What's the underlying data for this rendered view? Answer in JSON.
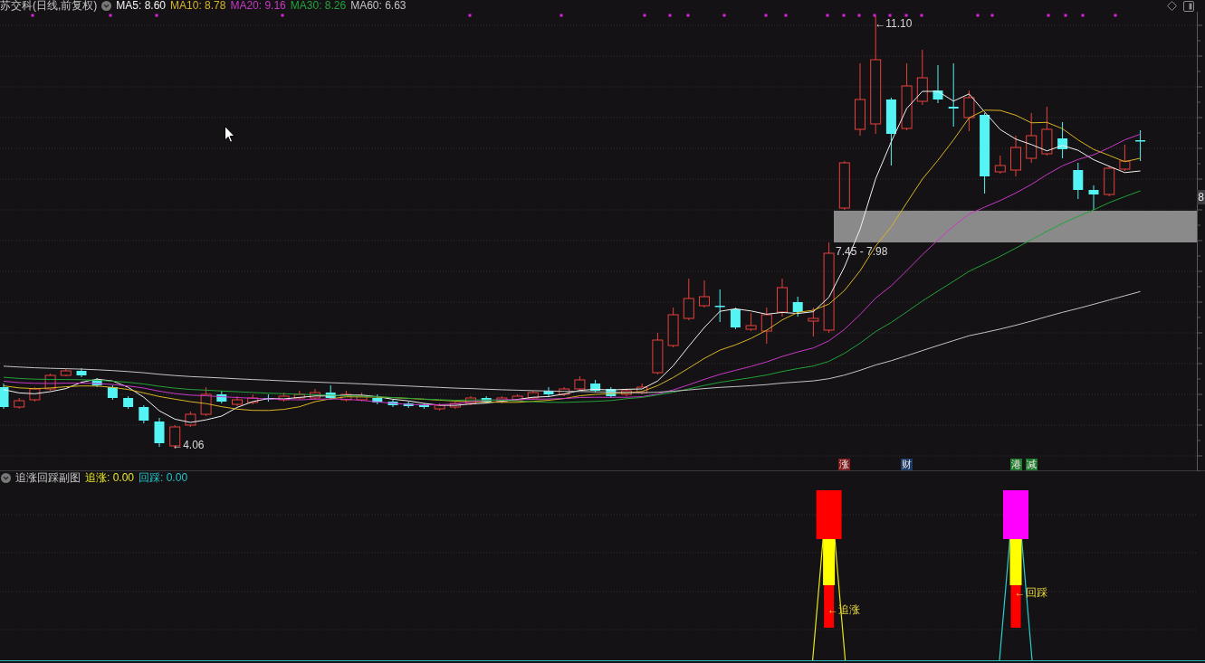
{
  "main_chart": {
    "title": "苏交科(日线,前复权)",
    "indicators": [
      {
        "label": "MA5: 8.60",
        "color": "#f2f2f2"
      },
      {
        "label": "MA10: 8.78",
        "color": "#d8b424"
      },
      {
        "label": "MA20: 9.16",
        "color": "#c838c8"
      },
      {
        "label": "MA30: 8.26",
        "color": "#22a23a"
      },
      {
        "label": "MA60: 6.63",
        "color": "#c4c4c4"
      }
    ],
    "price_axis_label": "8",
    "annotations": [
      {
        "kind": "high",
        "text": "←11.10"
      },
      {
        "kind": "low",
        "text": "←4.06"
      }
    ],
    "zone": {
      "label": "7.45 - 7.98"
    },
    "event_markers": [
      {
        "label": "涨",
        "color": "#7c1c1c"
      },
      {
        "label": "财",
        "color": "#1c3c68"
      },
      {
        "label": "港",
        "color": "#1c7a2c"
      },
      {
        "label": "减",
        "color": "#1c7a2c"
      }
    ]
  },
  "sub_chart": {
    "title": "追涨回踩副图",
    "indicators": [
      {
        "label": "追涨: 0.00",
        "color": "#e6e61e"
      },
      {
        "label": "回踩: 0.00",
        "color": "#22c4c8"
      }
    ],
    "signals": [
      {
        "kind": "chase",
        "label": "←追涨"
      },
      {
        "kind": "pullback",
        "label": "←回踩"
      }
    ]
  }
}
